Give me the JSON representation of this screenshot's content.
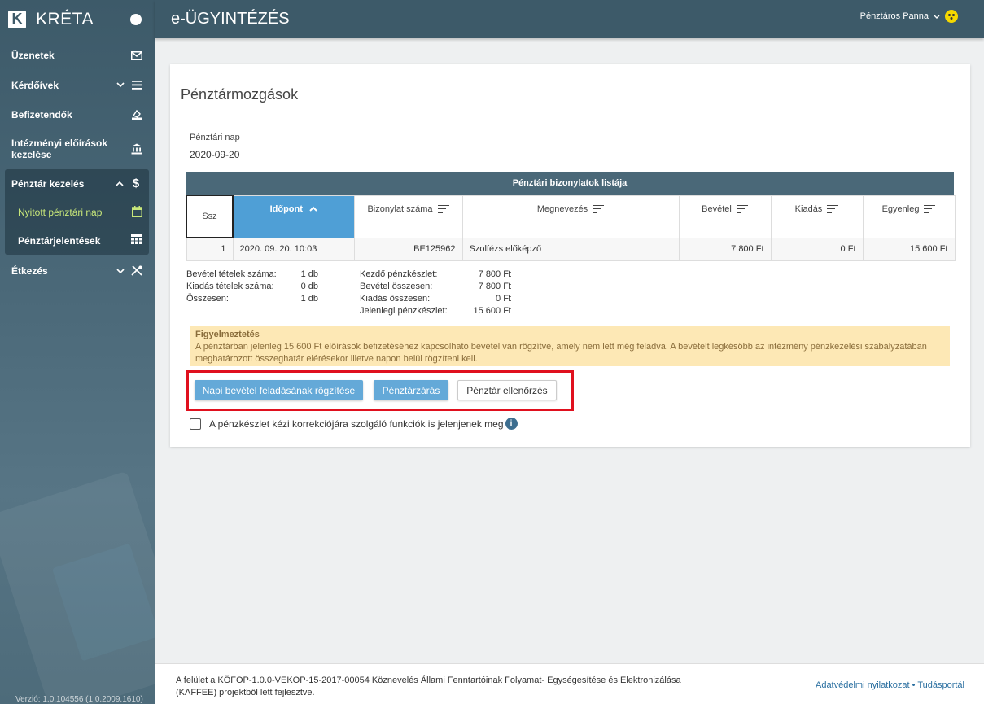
{
  "brand": {
    "name": "KRÉTA",
    "logo_letter": "K"
  },
  "header": {
    "title": "e-ÜGYINTÉZÉS",
    "user": "Pénztáros Panna"
  },
  "sidebar": {
    "items": [
      {
        "label": "Üzenetek",
        "icon": "mail-icon"
      },
      {
        "label": "Kérdőívek",
        "icon": "list-icon"
      },
      {
        "label": "Befizetendők",
        "icon": "payment-icon"
      },
      {
        "label": "Intézményi előírások kezelése",
        "icon": "bank-icon"
      }
    ],
    "group": {
      "label": "Pénztár kezelés",
      "icon": "dollar-icon",
      "sub": [
        {
          "label": "Nyitott pénztári nap",
          "icon": "calendar-icon"
        },
        {
          "label": "Pénztárjelentések",
          "icon": "table-icon"
        }
      ]
    },
    "after": {
      "label": "Étkezés",
      "icon": "cutlery-icon"
    },
    "version": "Verzió: 1.0.104556 (1.0.2009.1610)"
  },
  "main": {
    "title": "Pénztármozgások",
    "field": {
      "label": "Pénztári nap",
      "value": "2020-09-20"
    },
    "table": {
      "title": "Pénztári bizonylatok listája",
      "columns": [
        "Ssz",
        "Időpont",
        "Bizonylat száma",
        "Megnevezés",
        "Bevétel",
        "Kiadás",
        "Egyenleg"
      ],
      "rows": [
        [
          "1",
          "2020. 09. 20. 10:03",
          "BE125962",
          "Szolfézs előképző",
          "7 800 Ft",
          "0 Ft",
          "15 600 Ft"
        ]
      ]
    },
    "summary_left": [
      {
        "k": "Bevétel tételek száma:",
        "v": "1 db"
      },
      {
        "k": "Kiadás tételek száma:",
        "v": "0 db"
      },
      {
        "k": "Összesen:",
        "v": "1 db"
      }
    ],
    "summary_right": [
      {
        "k": "Kezdő pénzkészlet:",
        "v": "7 800 Ft"
      },
      {
        "k": "Bevétel összesen:",
        "v": "7 800 Ft"
      },
      {
        "k": "Kiadás összesen:",
        "v": "0 Ft"
      },
      {
        "k": "Jelenlegi pénzkészlet:",
        "v": "15 600 Ft"
      }
    ],
    "warning": {
      "title": "Figyelmeztetés",
      "text": "A pénztárban jelenleg 15 600 Ft előírások befizetéséhez kapcsolható bevétel van rögzítve, amely nem lett még feladva. A bevételt legkésőbb az intézmény pénzkezelési szabályzatában meghatározott összeghatár elérésekor illetve napon belül rögzíteni kell."
    },
    "buttons": {
      "record": "Napi bevétel feladásának rögzítése",
      "close": "Pénztárzárás",
      "check": "Pénztár ellenőrzés"
    },
    "checkbox_label": "A pénzkészlet kézi korrekciójára szolgáló funkciók is jelenjenek meg",
    "info": "i"
  },
  "footer": {
    "text": "A felület a KÖFOP-1.0.0-VEKOP-15-2017-00054 Köznevelés Állami Fenntartóinak Folyamat- Egységesítése és Elektronizálása (KAFFEE) projektből lett fejlesztve.",
    "link1": "Adatvédelmi nyilatkozat",
    "sep": " • ",
    "link2": "Tudásportál"
  },
  "colors": {
    "header": "#3d5a69",
    "primary_button": "#64a9d8",
    "warning_bg": "#fde8b5",
    "highlight_frame": "#e0101e",
    "active_nav": "#c9e87a"
  }
}
